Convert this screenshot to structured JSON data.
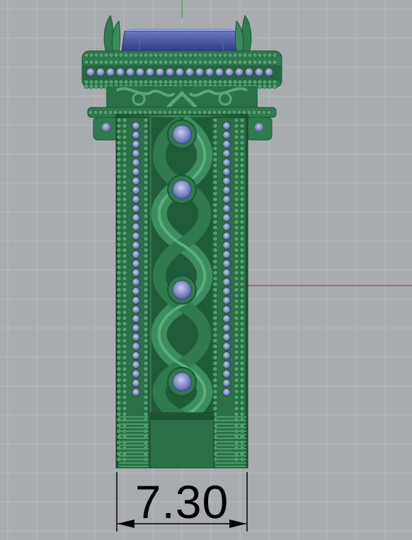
{
  "viewport": {
    "name": "front-view-viewport",
    "background_color": "#a9acaf",
    "grid_color": "#b9bcbf",
    "x_axis_color": "#c0262b",
    "y_axis_color": "#2c9a3c"
  },
  "model": {
    "name": "ring-model",
    "metal_color": "#2f7a4e",
    "metal_dark_color": "#1c5535",
    "metal_light_color": "#4fa26f",
    "stone_color": "#8b93d0",
    "center_stone_color": "#3e4e9a"
  },
  "dimension": {
    "value": "7.30",
    "line_color": "#000000"
  }
}
